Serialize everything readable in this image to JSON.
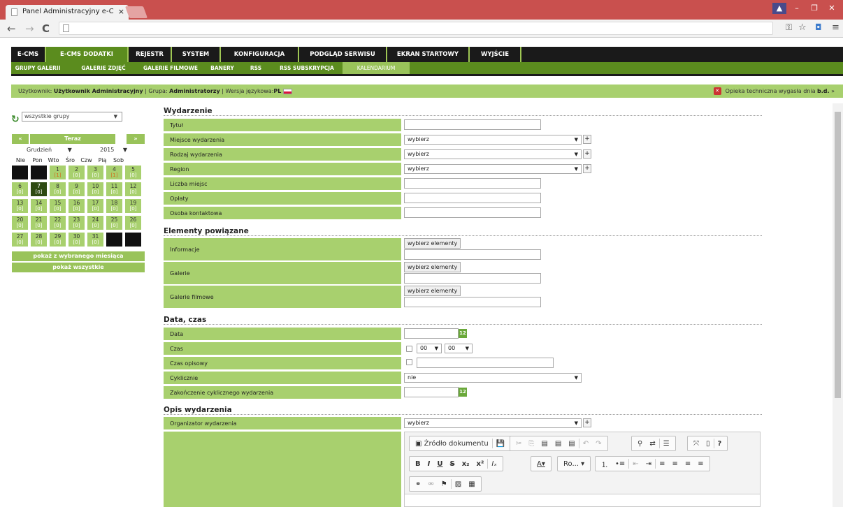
{
  "browser": {
    "tab_title": "Panel Administracyjny e-C",
    "tab_close": "×"
  },
  "top_menu": [
    "E-CMS",
    "E-CMS DODATKI",
    "REJESTR",
    "SYSTEM",
    "KONFIGURACJA",
    "PODGLĄD SERWISU",
    "EKRAN STARTOWY",
    "WYJŚCIE"
  ],
  "sub_menu": [
    "GRUPY GALERII",
    "GALERIE ZDJĘĆ",
    "GALERIE FILMOWE",
    "BANERY",
    "RSS",
    "RSS SUBSKRYPCJA",
    "KALENDARIUM"
  ],
  "userbar": {
    "user_label": "Użytkownik:",
    "user_value": "Użytkownik Administracyjny",
    "group_label": "| Grupa:",
    "group_value": "Administratorzy",
    "lang_label": "| Wersja językowa:",
    "lang_value": "PL",
    "support_text": "Opieka techniczna wygasła dnia",
    "support_date": "b.d.",
    "support_arrow": "»"
  },
  "calendar": {
    "group_select": "wszystkie grupy",
    "prev": "«",
    "today": "Teraz",
    "next": "»",
    "month": "Grudzień",
    "year": "2015",
    "days": [
      "Nie",
      "Pon",
      "Wto",
      "Śro",
      "Czw",
      "Pią",
      "Sob"
    ],
    "counts": [
      "[0]",
      "[1]"
    ],
    "show_month": "pokaż z wybranego miesiąca",
    "show_all": "pokaż wszystkie"
  },
  "form": {
    "sections": [
      "Wydarzenie",
      "Elementy powiązane",
      "Data, czas",
      "Opis wydarzenia"
    ],
    "labels": [
      "Tytuł",
      "Miejsce wydarzenia",
      "Rodzaj wydarzenia",
      "Region",
      "Liczba miejsc",
      "Opłaty",
      "Osoba kontaktowa",
      "Informacje",
      "Galerie",
      "Galerie filmowe",
      "Data",
      "Czas",
      "Czas opisowy",
      "Cyklicznie",
      "Zakończenie cyklicznego wydarzenia",
      "Organizator wydarzenia"
    ],
    "select_default": "wybierz",
    "plus": "+",
    "choose_elements": "wybierz elementy",
    "hour": "00",
    "minute": "00",
    "cyclic_value": "nie",
    "cal_icon": "12"
  },
  "editor": {
    "source": "Źródło dokumentu",
    "format": "Ro...",
    "help": "?"
  }
}
